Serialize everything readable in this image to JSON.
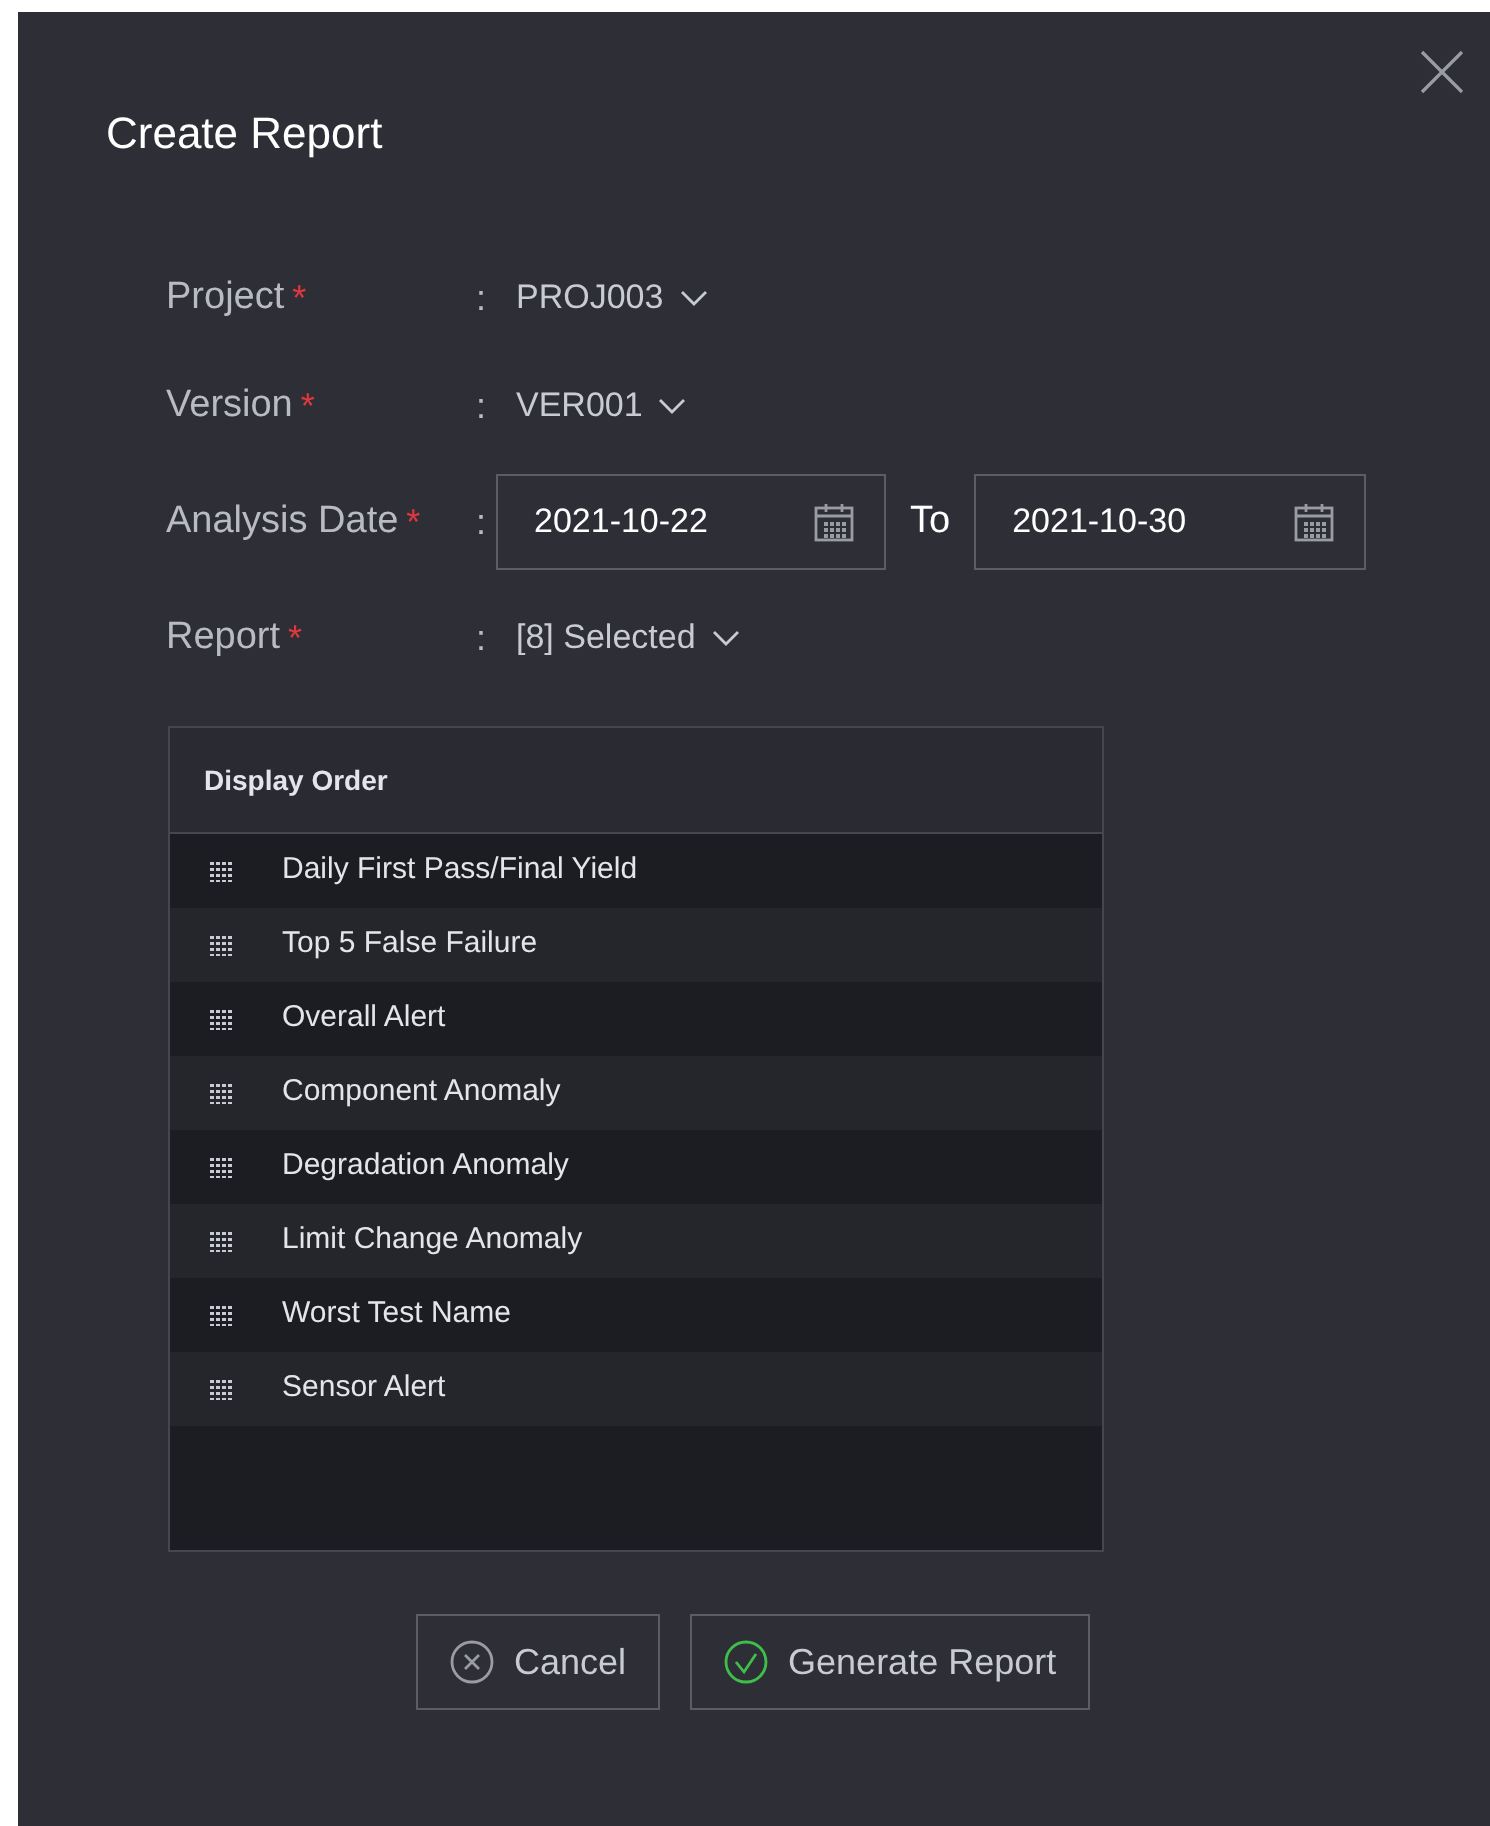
{
  "dialog": {
    "title": "Create Report"
  },
  "fields": [
    {
      "kind": "select",
      "label": "Project",
      "required_mark": "*",
      "colon": ":",
      "value": "PROJ003"
    },
    {
      "kind": "select",
      "label": "Version",
      "required_mark": "*",
      "colon": ":",
      "value": "VER001"
    },
    {
      "kind": "date_range",
      "label": "Analysis Date",
      "required_mark": "*",
      "colon": ":",
      "from": "2021-10-22",
      "separator": "To",
      "to": "2021-10-30"
    },
    {
      "kind": "select",
      "label": "Report",
      "required_mark": "*",
      "colon": ":",
      "value": "[8] Selected"
    }
  ],
  "display_order": {
    "header": "Display Order",
    "items": [
      "Daily First Pass/Final Yield",
      "Top 5 False Failure",
      "Overall Alert",
      "Component Anomaly",
      "Degradation Anomaly",
      "Limit Change Anomaly",
      "Worst Test Name",
      "Sensor Alert"
    ]
  },
  "buttons": [
    {
      "kind": "cancel",
      "label": "Cancel"
    },
    {
      "kind": "confirm",
      "label": "Generate Report"
    }
  ]
}
